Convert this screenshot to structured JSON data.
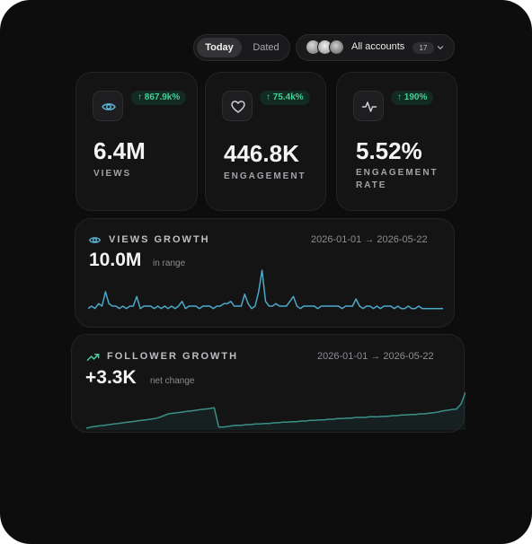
{
  "toolbar": {
    "range_options": [
      "Today",
      "Dated"
    ],
    "selected_range": "Today",
    "accounts_label": "All accounts",
    "accounts_count": "17"
  },
  "stats": [
    {
      "id": "views",
      "icon": "eye-icon",
      "value": "6.4M",
      "label": "VIEWS",
      "delta": "↑ 867.9k%"
    },
    {
      "id": "engagement",
      "icon": "heart-icon",
      "value": "446.8K",
      "label": "ENGAGEMENT",
      "delta": "↑ 75.4k%"
    },
    {
      "id": "engagement_rate",
      "icon": "activity-icon",
      "value": "5.52%",
      "label_line1": "ENGAGEMENT",
      "label_line2": "RATE",
      "delta": "↑ 190%"
    }
  ],
  "views_growth": {
    "title": "VIEWS GROWTH",
    "range": "2026-01-01 → 2026-05-22",
    "value": "10.0M",
    "caption": "in range"
  },
  "follower_growth": {
    "title": "FOLLOWER GROWTH",
    "range": "2026-01-01 → 2026-05-22",
    "value": "+3.3K",
    "caption": "net change"
  },
  "colors": {
    "accent_green": "#43d09a",
    "views_line": "#4aa8c8",
    "follower_line": "#3a8f86",
    "background": "#0d0d0e"
  },
  "chart_data": [
    {
      "type": "line",
      "title": "",
      "series": [
        {
          "values": [
            2,
            3,
            2,
            4,
            3,
            9,
            4,
            3,
            3,
            2,
            3,
            2,
            3,
            3,
            7,
            2,
            3,
            3,
            3,
            2,
            3,
            2,
            3,
            2,
            3,
            2,
            3,
            5,
            2,
            3,
            3,
            3,
            2,
            3,
            3,
            3,
            2,
            3,
            3,
            4,
            4,
            5,
            3,
            3,
            3,
            8,
            4,
            2,
            3,
            9,
            18,
            5,
            3,
            3,
            4,
            3,
            3,
            3,
            5,
            7,
            3,
            2,
            3,
            3,
            3,
            3,
            2,
            3,
            3,
            3,
            3,
            3,
            3,
            2,
            3,
            3,
            3,
            6,
            3,
            2,
            3,
            3,
            2,
            3,
            2,
            3,
            3,
            3,
            2,
            3,
            2,
            2,
            3,
            2,
            2,
            3,
            2,
            2,
            2,
            2,
            2,
            2,
            2
          ]
        }
      ]
    },
    {
      "type": "area",
      "title": "",
      "series": [
        {
          "values": [
            0,
            2,
            3,
            4,
            5,
            6,
            7,
            8,
            9,
            10,
            11,
            12,
            13,
            14,
            15,
            16,
            18,
            21,
            24,
            25,
            26,
            27,
            28,
            29,
            30,
            31,
            32,
            33,
            34,
            2,
            2,
            3,
            4,
            5,
            5,
            6,
            6,
            7,
            7,
            8,
            8,
            9,
            9,
            10,
            10,
            11,
            11,
            12,
            12,
            13,
            13,
            14,
            14,
            15,
            15,
            16,
            16,
            17,
            17,
            18,
            18,
            18,
            19,
            19,
            19,
            20,
            20,
            21,
            21,
            22,
            22,
            23,
            23,
            24,
            24,
            25,
            26,
            27,
            29,
            30,
            31,
            32,
            40,
            60
          ]
        }
      ]
    }
  ]
}
